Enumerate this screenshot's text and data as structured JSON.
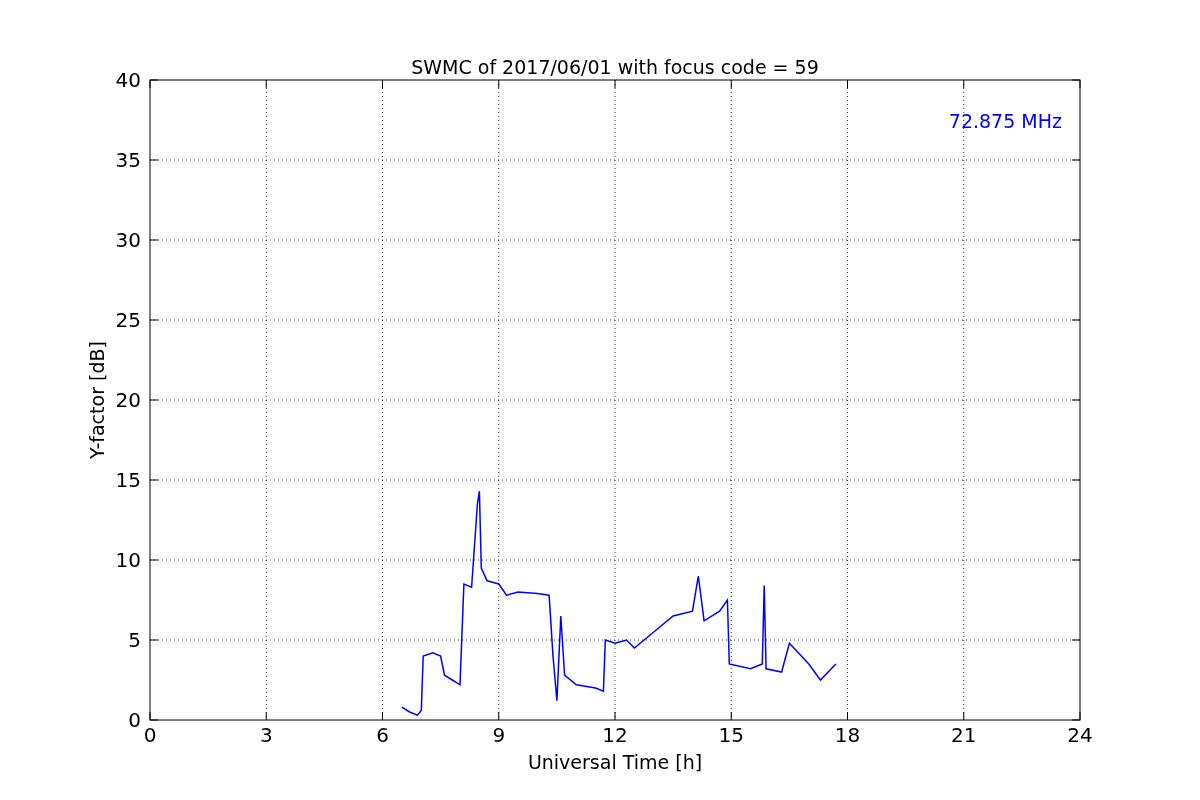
{
  "chart_data": {
    "type": "line",
    "title": "SWMC of 2017/06/01 with focus code = 59",
    "xlabel": "Universal Time [h]",
    "ylabel": "Y-factor [dB]",
    "x": [
      6.5,
      6.7,
      6.9,
      7.0,
      7.05,
      7.3,
      7.5,
      7.6,
      7.8,
      8.0,
      8.1,
      8.3,
      8.45,
      8.5,
      8.55,
      8.7,
      9.0,
      9.2,
      9.5,
      10.0,
      10.3,
      10.4,
      10.5,
      10.6,
      10.7,
      11.0,
      11.5,
      11.7,
      11.75,
      12.0,
      12.3,
      12.5,
      13.0,
      13.5,
      14.0,
      14.15,
      14.3,
      14.7,
      14.9,
      14.95,
      15.5,
      15.8,
      15.85,
      15.9,
      16.3,
      16.5,
      17.0,
      17.3,
      17.7
    ],
    "series": [
      {
        "name": "72.875 MHz",
        "color": "#0000ff",
        "values": [
          0.8,
          0.5,
          0.3,
          0.6,
          4.0,
          4.2,
          4.0,
          2.8,
          2.5,
          2.2,
          8.5,
          8.3,
          13.5,
          14.3,
          9.5,
          8.7,
          8.5,
          7.8,
          8.0,
          7.9,
          7.8,
          4.0,
          1.2,
          6.5,
          2.8,
          2.2,
          2.0,
          1.8,
          5.0,
          4.8,
          5.0,
          4.5,
          5.5,
          6.5,
          6.8,
          9.0,
          6.2,
          6.8,
          7.5,
          3.5,
          3.2,
          3.5,
          8.4,
          3.2,
          3.0,
          4.8,
          3.5,
          2.5,
          3.5
        ]
      }
    ],
    "xlim": [
      0,
      24
    ],
    "ylim": [
      0,
      40
    ],
    "xticks": [
      0,
      3,
      6,
      9,
      12,
      15,
      18,
      21,
      24
    ],
    "yticks": [
      0,
      5,
      10,
      15,
      20,
      25,
      30,
      35,
      40
    ],
    "grid": true
  }
}
